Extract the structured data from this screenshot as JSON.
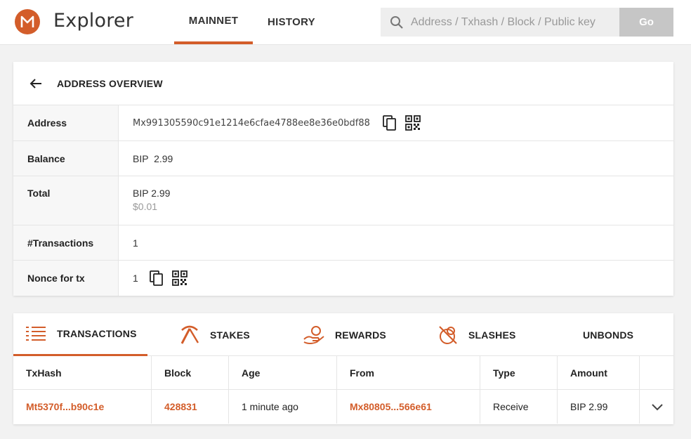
{
  "header": {
    "brand": "Explorer",
    "logo_letter": "M",
    "nav": [
      "MAINNET",
      "HISTORY"
    ],
    "search_placeholder": "Address / Txhash / Block / Public key",
    "go_label": "Go"
  },
  "overview": {
    "title": "ADDRESS OVERVIEW",
    "rows": {
      "address": {
        "label": "Address",
        "value": "Mx991305590c91e1214e6cfae4788ee8e36e0bdf88"
      },
      "balance": {
        "label": "Balance",
        "value": "BIP  2.99"
      },
      "total": {
        "label": "Total",
        "value": "BIP 2.99",
        "usd": "$0.01"
      },
      "transactions": {
        "label": "#Transactions",
        "value": "1"
      },
      "nonce": {
        "label": "Nonce for tx",
        "value": "1"
      }
    }
  },
  "tabs": [
    "TRANSACTIONS",
    "STAKES",
    "REWARDS",
    "SLASHES",
    "UNBONDS"
  ],
  "table": {
    "headers": [
      "TxHash",
      "Block",
      "Age",
      "From",
      "Type",
      "Amount"
    ],
    "rows": [
      {
        "txhash": "Mt5370f...b90c1e",
        "block": "428831",
        "age": "1 minute ago",
        "from": "Mx80805...566e61",
        "type": "Receive",
        "amount": "BIP 2.99"
      }
    ]
  },
  "colors": {
    "accent": "#d35d2a",
    "go_button": "#c6c6c6"
  }
}
